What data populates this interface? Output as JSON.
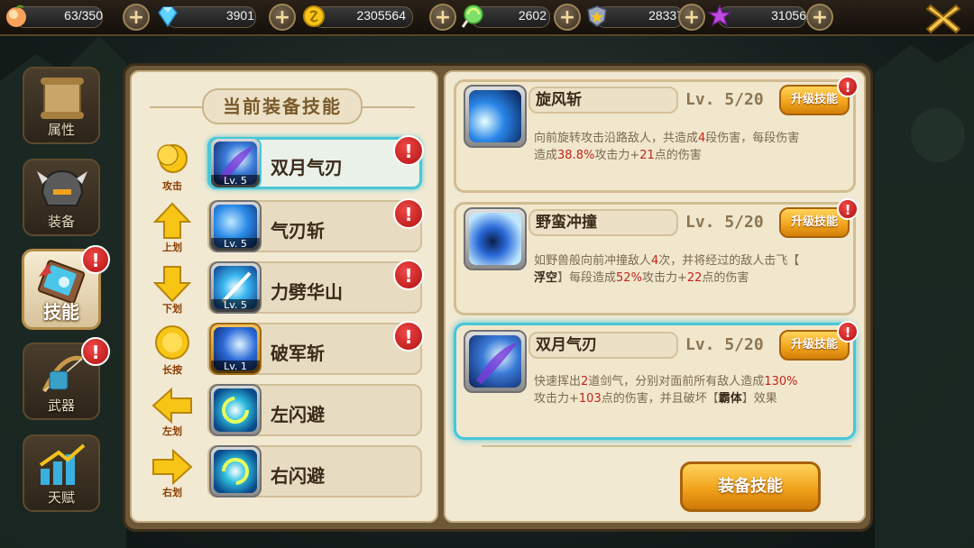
{
  "resources": [
    {
      "name": "stamina",
      "icon": "peach-icon",
      "value": "63/350"
    },
    {
      "name": "diamond",
      "icon": "diamond-icon",
      "value": "3901"
    },
    {
      "name": "gold",
      "icon": "gold-coin-icon",
      "value": "2305564"
    },
    {
      "name": "candy",
      "icon": "lollipop-icon",
      "value": "2602"
    },
    {
      "name": "honor",
      "icon": "shield-icon",
      "value": "28337"
    },
    {
      "name": "star",
      "icon": "purple-star-icon",
      "value": "31056"
    }
  ],
  "side_tabs": [
    {
      "label": "属性",
      "icon": "scroll-icon"
    },
    {
      "label": "装备",
      "icon": "helmet-icon"
    },
    {
      "label": "技能",
      "icon": "skill-book-icon",
      "active": true,
      "badge": "!"
    },
    {
      "label": "武器",
      "icon": "weapon-icon",
      "badge": "!"
    },
    {
      "label": "天赋",
      "icon": "talent-chart-icon"
    }
  ],
  "equipped": {
    "title": "当前装备技能",
    "rows": [
      {
        "gesture": "攻击",
        "name": "双月气刃",
        "level": "Lv. 5",
        "badge": "!",
        "selected": true
      },
      {
        "gesture": "上划",
        "name": "气刃斩",
        "level": "Lv. 5",
        "badge": "!"
      },
      {
        "gesture": "下划",
        "name": "力劈华山",
        "level": "Lv. 5",
        "badge": "!"
      },
      {
        "gesture": "长按",
        "name": "破军斩",
        "level": "Lv. 1",
        "badge": "!"
      },
      {
        "gesture": "左划",
        "name": "左闪避",
        "level": ""
      },
      {
        "gesture": "右划",
        "name": "右闪避",
        "level": ""
      }
    ]
  },
  "skills": [
    {
      "name": "旋风斩",
      "level": "Lv.  5/20",
      "button": "升级技能",
      "badge": "!",
      "desc": [
        [
          {
            "t": "向前旋转攻击沿路敌人，共造成"
          },
          {
            "t": "4",
            "c": "hl"
          },
          {
            "t": "段伤害，每段伤害"
          }
        ],
        [
          {
            "t": "造成"
          },
          {
            "t": "38.8%",
            "c": "hl"
          },
          {
            "t": "攻击力+"
          },
          {
            "t": "21",
            "c": "hl"
          },
          {
            "t": "点的伤害"
          }
        ]
      ]
    },
    {
      "name": "野蛮冲撞",
      "level": "Lv.  5/20",
      "button": "升级技能",
      "badge": "!",
      "desc": [
        [
          {
            "t": "如野兽般向前冲撞敌人"
          },
          {
            "t": "4",
            "c": "hl"
          },
          {
            "t": "次，并将经过的敌人击飞【"
          }
        ],
        [
          {
            "t": "浮空",
            "c": "bk"
          },
          {
            "t": "】每段造成"
          },
          {
            "t": "52%",
            "c": "hl"
          },
          {
            "t": "攻击力+"
          },
          {
            "t": "22",
            "c": "hl"
          },
          {
            "t": "点的伤害"
          }
        ]
      ]
    },
    {
      "name": "双月气刃",
      "level": "Lv.  5/20",
      "button": "升级技能",
      "badge": "!",
      "selected": true,
      "desc": [
        [
          {
            "t": "快速挥出"
          },
          {
            "t": "2",
            "c": "hl"
          },
          {
            "t": "道剑气，分别对面前所有敌人造成"
          },
          {
            "t": "130%",
            "c": "hl"
          }
        ],
        [
          {
            "t": "攻击力+"
          },
          {
            "t": "103",
            "c": "hl"
          },
          {
            "t": "点的伤害，并且破坏【"
          },
          {
            "t": "霸体",
            "c": "bk"
          },
          {
            "t": "】效果"
          }
        ]
      ]
    }
  ],
  "equip_button": "装备技能",
  "colors": {
    "accent": "#49c6d8",
    "highlight": "#c2251a",
    "button": "#f0a21a",
    "badge": "#d81e1e"
  }
}
